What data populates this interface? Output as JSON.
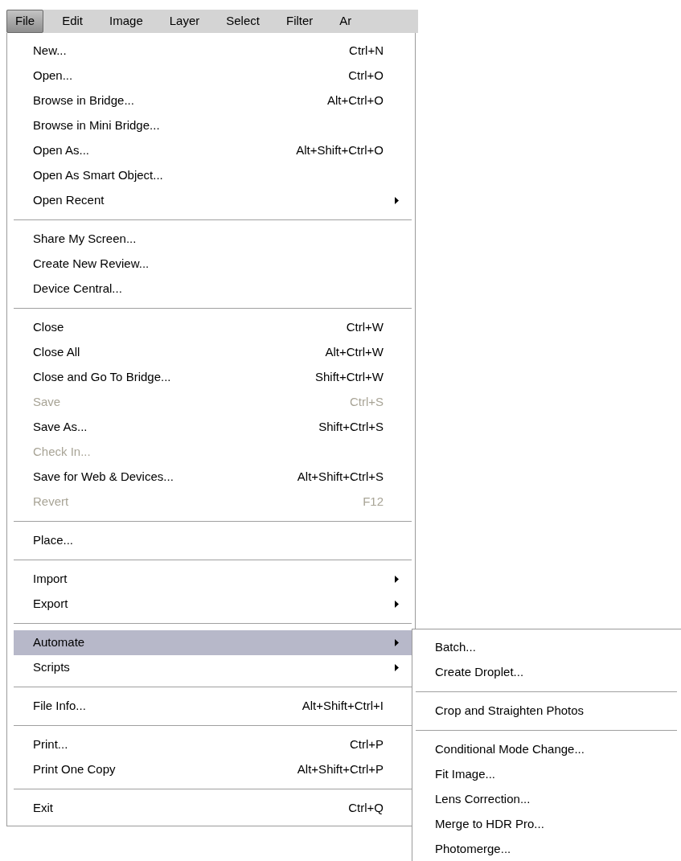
{
  "menu_bar": [
    {
      "label": "File",
      "selected": true
    },
    {
      "label": "Edit",
      "selected": false
    },
    {
      "label": "Image",
      "selected": false
    },
    {
      "label": "Layer",
      "selected": false
    },
    {
      "label": "Select",
      "selected": false
    },
    {
      "label": "Filter",
      "selected": false
    },
    {
      "label": "Ar",
      "selected": false
    }
  ],
  "file_menu": {
    "sections": [
      [
        {
          "label": "New...",
          "shortcut": "Ctrl+N",
          "disabled": false,
          "has_submenu": false,
          "selected": false
        },
        {
          "label": "Open...",
          "shortcut": "Ctrl+O",
          "disabled": false,
          "has_submenu": false,
          "selected": false
        },
        {
          "label": "Browse in Bridge...",
          "shortcut": "Alt+Ctrl+O",
          "disabled": false,
          "has_submenu": false,
          "selected": false
        },
        {
          "label": "Browse in Mini Bridge...",
          "disabled": false,
          "has_submenu": false,
          "selected": false
        },
        {
          "label": "Open As...",
          "shortcut": "Alt+Shift+Ctrl+O",
          "disabled": false,
          "has_submenu": false,
          "selected": false
        },
        {
          "label": "Open As Smart Object...",
          "disabled": false,
          "has_submenu": false,
          "selected": false
        },
        {
          "label": "Open Recent",
          "disabled": false,
          "has_submenu": true,
          "selected": false
        }
      ],
      [
        {
          "label": "Share My Screen...",
          "disabled": false,
          "has_submenu": false,
          "selected": false
        },
        {
          "label": "Create New Review...",
          "disabled": false,
          "has_submenu": false,
          "selected": false
        },
        {
          "label": "Device Central...",
          "disabled": false,
          "has_submenu": false,
          "selected": false
        }
      ],
      [
        {
          "label": "Close",
          "shortcut": "Ctrl+W",
          "disabled": false,
          "has_submenu": false,
          "selected": false
        },
        {
          "label": "Close All",
          "shortcut": "Alt+Ctrl+W",
          "disabled": false,
          "has_submenu": false,
          "selected": false
        },
        {
          "label": "Close and Go To Bridge...",
          "shortcut": "Shift+Ctrl+W",
          "disabled": false,
          "has_submenu": false,
          "selected": false
        },
        {
          "label": "Save",
          "shortcut": "Ctrl+S",
          "disabled": true,
          "has_submenu": false,
          "selected": false
        },
        {
          "label": "Save As...",
          "shortcut": "Shift+Ctrl+S",
          "disabled": false,
          "has_submenu": false,
          "selected": false
        },
        {
          "label": "Check In...",
          "disabled": true,
          "has_submenu": false,
          "selected": false
        },
        {
          "label": "Save for Web & Devices...",
          "shortcut": "Alt+Shift+Ctrl+S",
          "disabled": false,
          "has_submenu": false,
          "selected": false
        },
        {
          "label": "Revert",
          "shortcut": "F12",
          "disabled": true,
          "has_submenu": false,
          "selected": false
        }
      ],
      [
        {
          "label": "Place...",
          "disabled": false,
          "has_submenu": false,
          "selected": false
        }
      ],
      [
        {
          "label": "Import",
          "disabled": false,
          "has_submenu": true,
          "selected": false
        },
        {
          "label": "Export",
          "disabled": false,
          "has_submenu": true,
          "selected": false
        }
      ],
      [
        {
          "label": "Automate",
          "disabled": false,
          "has_submenu": true,
          "selected": true
        },
        {
          "label": "Scripts",
          "disabled": false,
          "has_submenu": true,
          "selected": false
        }
      ],
      [
        {
          "label": "File Info...",
          "shortcut": "Alt+Shift+Ctrl+I",
          "disabled": false,
          "has_submenu": false,
          "selected": false
        }
      ],
      [
        {
          "label": "Print...",
          "shortcut": "Ctrl+P",
          "disabled": false,
          "has_submenu": false,
          "selected": false
        },
        {
          "label": "Print One Copy",
          "shortcut": "Alt+Shift+Ctrl+P",
          "disabled": false,
          "has_submenu": false,
          "selected": false
        }
      ],
      [
        {
          "label": "Exit",
          "shortcut": "Ctrl+Q",
          "disabled": false,
          "has_submenu": false,
          "selected": false
        }
      ]
    ]
  },
  "automate_submenu": {
    "sections": [
      [
        "Batch...",
        "Create Droplet..."
      ],
      [
        "Crop and Straighten Photos"
      ],
      [
        "Conditional Mode Change...",
        "Fit Image...",
        "Lens Correction...",
        "Merge to HDR Pro...",
        "Photomerge..."
      ]
    ]
  }
}
